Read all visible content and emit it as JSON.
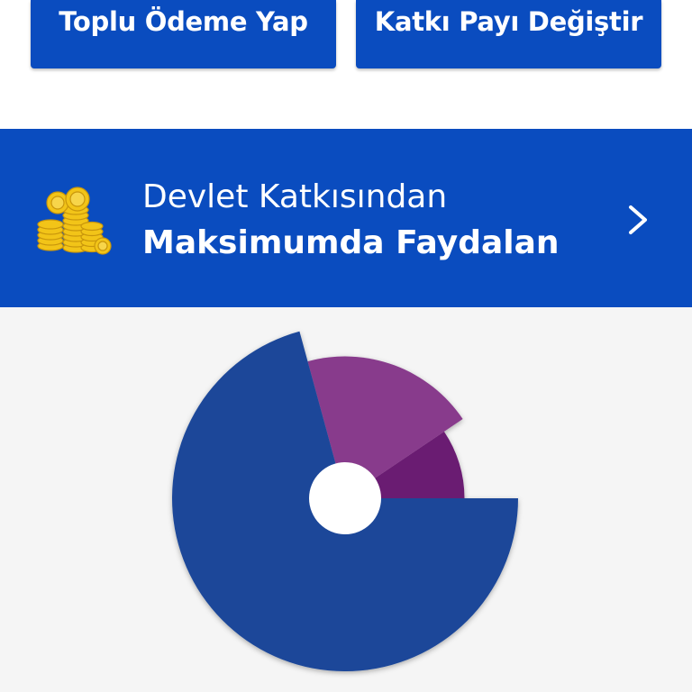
{
  "actions": {
    "bulk_payment_label": "Toplu Ödeme Yap",
    "change_contribution_label": "Katkı Payı Değiştir"
  },
  "banner": {
    "line1": "Devlet Katkısından",
    "line2": "Maksimumda Faydalan",
    "icon": "coin-stack-icon",
    "chevron_icon": "chevron-right-icon"
  },
  "colors": {
    "primary_blue": "#0a4cbf",
    "chart_blue": "#1a4799",
    "chart_purple": "#883a8c",
    "chart_dark_purple": "#6b1a72",
    "coin_gold": "#f2c418"
  },
  "chart_data": {
    "type": "pie",
    "variant": "polar-area",
    "slices": [
      {
        "value": 0.75,
        "relative_radius": 1.0,
        "color": "#1a4799"
      },
      {
        "value": 0.21,
        "relative_radius": 0.82,
        "color": "#883a8c"
      },
      {
        "value": 0.1,
        "relative_radius": 0.69,
        "color": "#6b1a72"
      }
    ]
  }
}
